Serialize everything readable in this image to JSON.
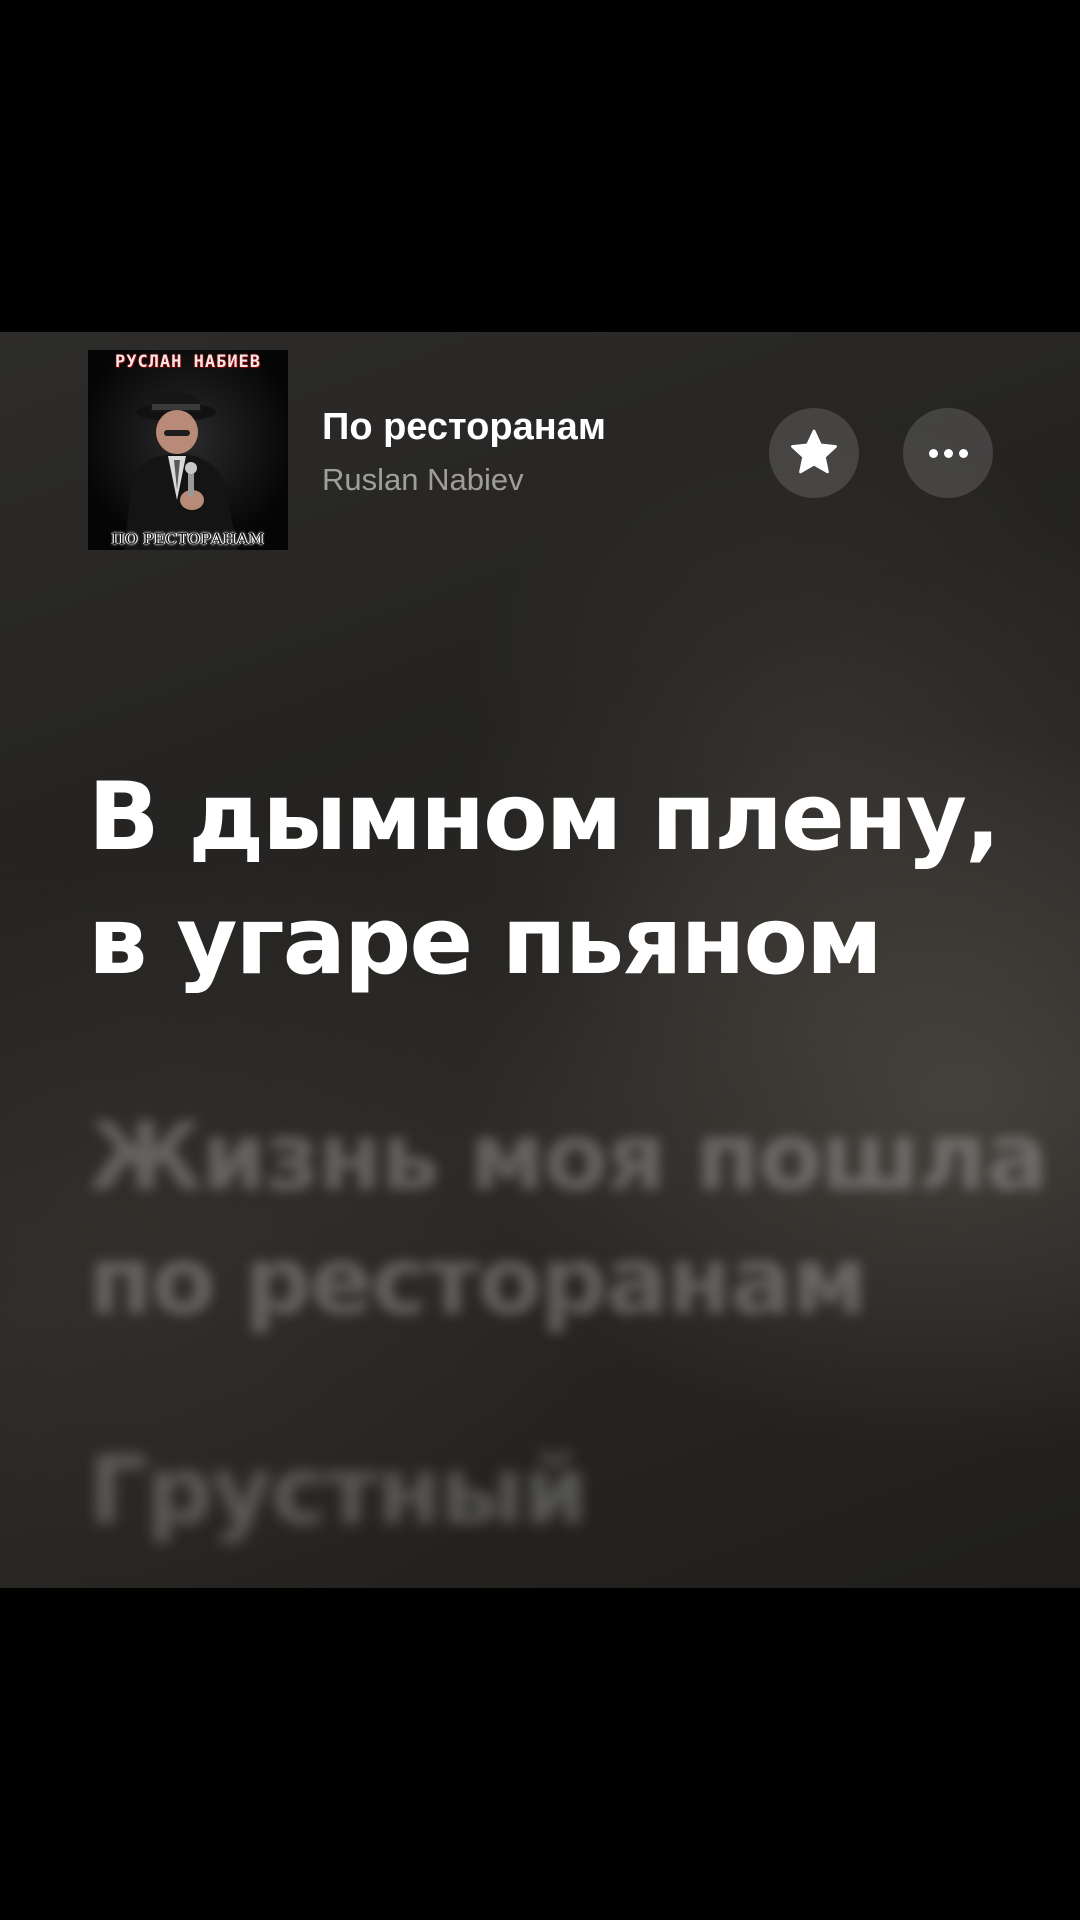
{
  "track": {
    "title": "По ресторанам",
    "artist": "Ruslan Nabiev"
  },
  "album_art": {
    "cover_text_top": "РУСЛАН НАБИЕВ",
    "cover_text_bottom": "ПО РЕСТОРАНАМ"
  },
  "actions": {
    "favorite_icon": "star-icon",
    "more_icon": "ellipsis-icon"
  },
  "lyrics": {
    "active": [
      "В дымном плену,",
      "в угаре пьяном"
    ],
    "next": [
      "Жизнь моя пошла",
      "по ресторанам"
    ],
    "later": [
      "Грустный"
    ]
  },
  "colors": {
    "text_primary": "#ffffff",
    "text_secondary": "rgba(255,255,255,0.55)",
    "button_bg": "rgba(255,255,255,0.14)",
    "background": "#2a2927",
    "letterbox": "#000000"
  }
}
